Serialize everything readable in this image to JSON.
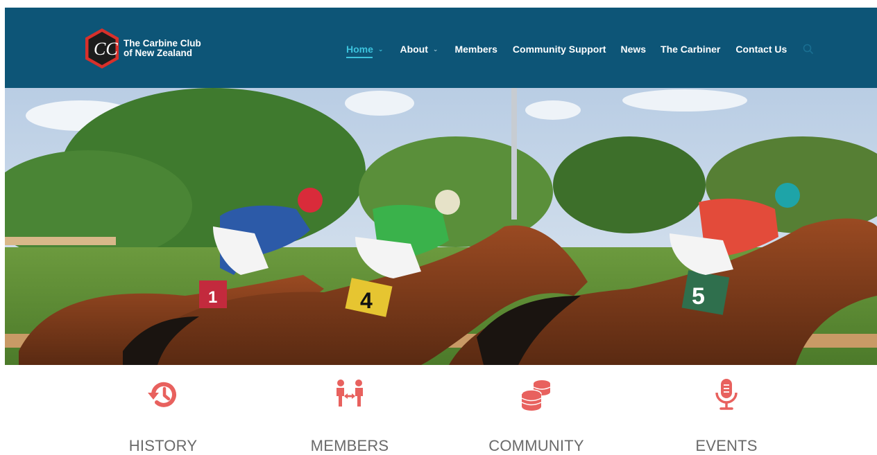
{
  "brand": {
    "name_line1": "The Carbine Club",
    "name_line2": "of New Zealand",
    "logo_monogram": "CC",
    "logo_icon": "hexagon-cc-logo-icon"
  },
  "nav": {
    "items": [
      {
        "label": "Home",
        "active": true,
        "has_dropdown": true
      },
      {
        "label": "About",
        "active": false,
        "has_dropdown": true
      },
      {
        "label": "Members",
        "active": false,
        "has_dropdown": false
      },
      {
        "label": "Community Support",
        "active": false,
        "has_dropdown": false
      },
      {
        "label": "News",
        "active": false,
        "has_dropdown": false
      },
      {
        "label": "The Carbiner",
        "active": false,
        "has_dropdown": false
      },
      {
        "label": "Contact Us",
        "active": false,
        "has_dropdown": false
      }
    ],
    "search_icon": "search-icon"
  },
  "hero": {
    "description_icon": "horse-racing-photo",
    "jockey_numbers": [
      "1",
      "4",
      "5"
    ]
  },
  "features": [
    {
      "label": "HISTORY",
      "icon": "history-icon"
    },
    {
      "label": "MEMBERS",
      "icon": "members-exchange-icon"
    },
    {
      "label": "COMMUNITY",
      "icon": "coins-stack-icon"
    },
    {
      "label": "EVENTS",
      "icon": "microphone-icon"
    }
  ],
  "colors": {
    "header_bg": "#0d5577",
    "nav_active": "#3cc3dd",
    "accent": "#e8615e",
    "feature_label": "#6a6a6a"
  }
}
